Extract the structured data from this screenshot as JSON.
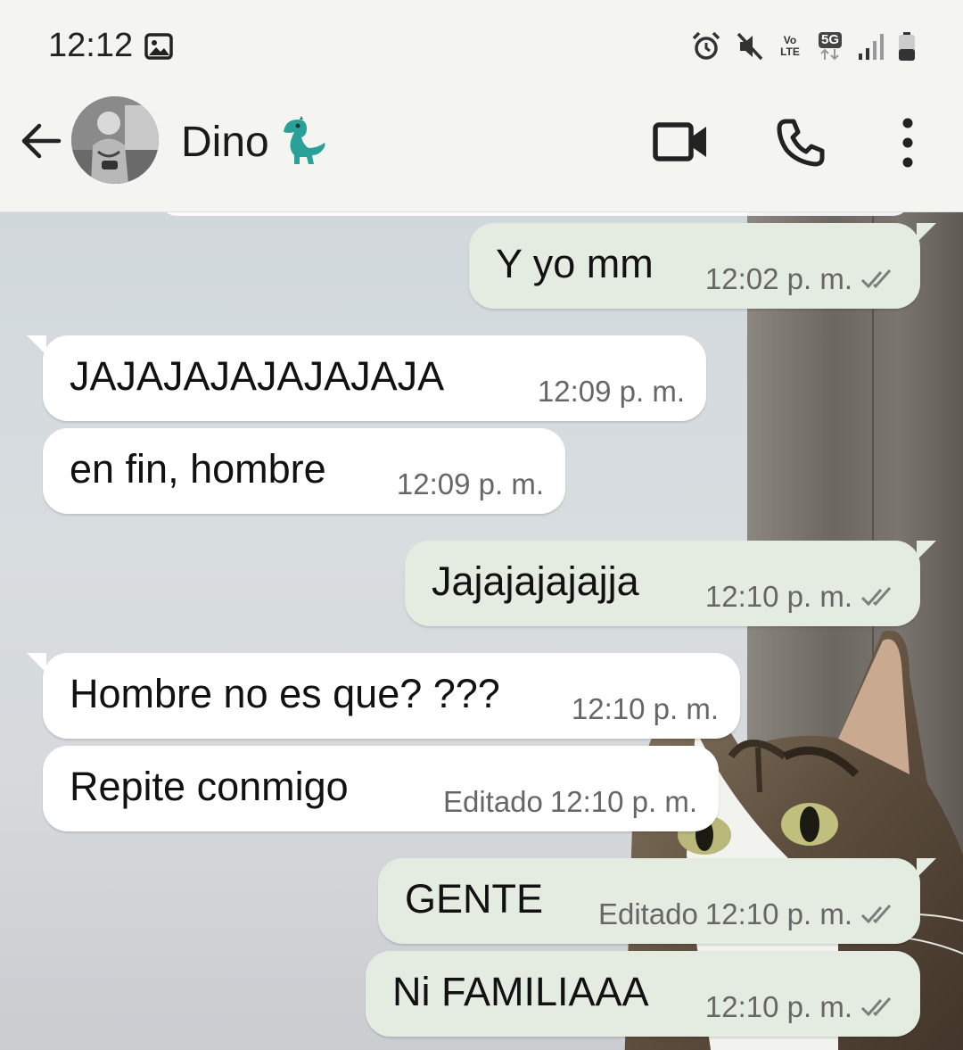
{
  "status_bar": {
    "time": "12:12",
    "icons": [
      "gallery-icon",
      "alarm-icon",
      "mute-icon",
      "volte-icon",
      "5g-icon",
      "signal-icon",
      "battery-icon"
    ],
    "volte_top": "Vo",
    "volte_bottom": "LTE",
    "network": "5G"
  },
  "header": {
    "contact_name": "Dino",
    "contact_emoji": "dinosaur-icon",
    "icons": [
      "back-arrow-icon",
      "video-call-icon",
      "phone-icon",
      "more-vert-icon"
    ]
  },
  "messages": [
    {
      "direction": "out",
      "text": "Y yo mm",
      "edited": "",
      "time": "12:02 p. m.",
      "status": "double-check-icon"
    },
    {
      "direction": "in",
      "text": "JAJAJAJAJAJAJAJA",
      "edited": "",
      "time": "12:09 p. m."
    },
    {
      "direction": "in",
      "text": "en fin, hombre",
      "edited": "",
      "time": "12:09 p. m."
    },
    {
      "direction": "out",
      "text": "Jajajajajajja",
      "edited": "",
      "time": "12:10 p. m.",
      "status": "double-check-icon"
    },
    {
      "direction": "in",
      "text": "Hombre no es que? ???",
      "edited": "",
      "time": "12:10 p. m."
    },
    {
      "direction": "in",
      "text": "Repite conmigo",
      "edited": "Editado",
      "time": "12:10 p. m."
    },
    {
      "direction": "out",
      "text": "GENTE",
      "edited": "Editado",
      "time": "12:10 p. m.",
      "status": "double-check-icon"
    },
    {
      "direction": "out",
      "text": "Ni FAMILIAAA",
      "edited": "",
      "time": "12:10 p. m.",
      "status": "double-check-icon"
    }
  ],
  "colors": {
    "incoming_bubble": "#ffffff",
    "outgoing_bubble": "#e4ebe1",
    "header_bg": "#f4f5f0",
    "tick_color": "#7a7f7c"
  }
}
